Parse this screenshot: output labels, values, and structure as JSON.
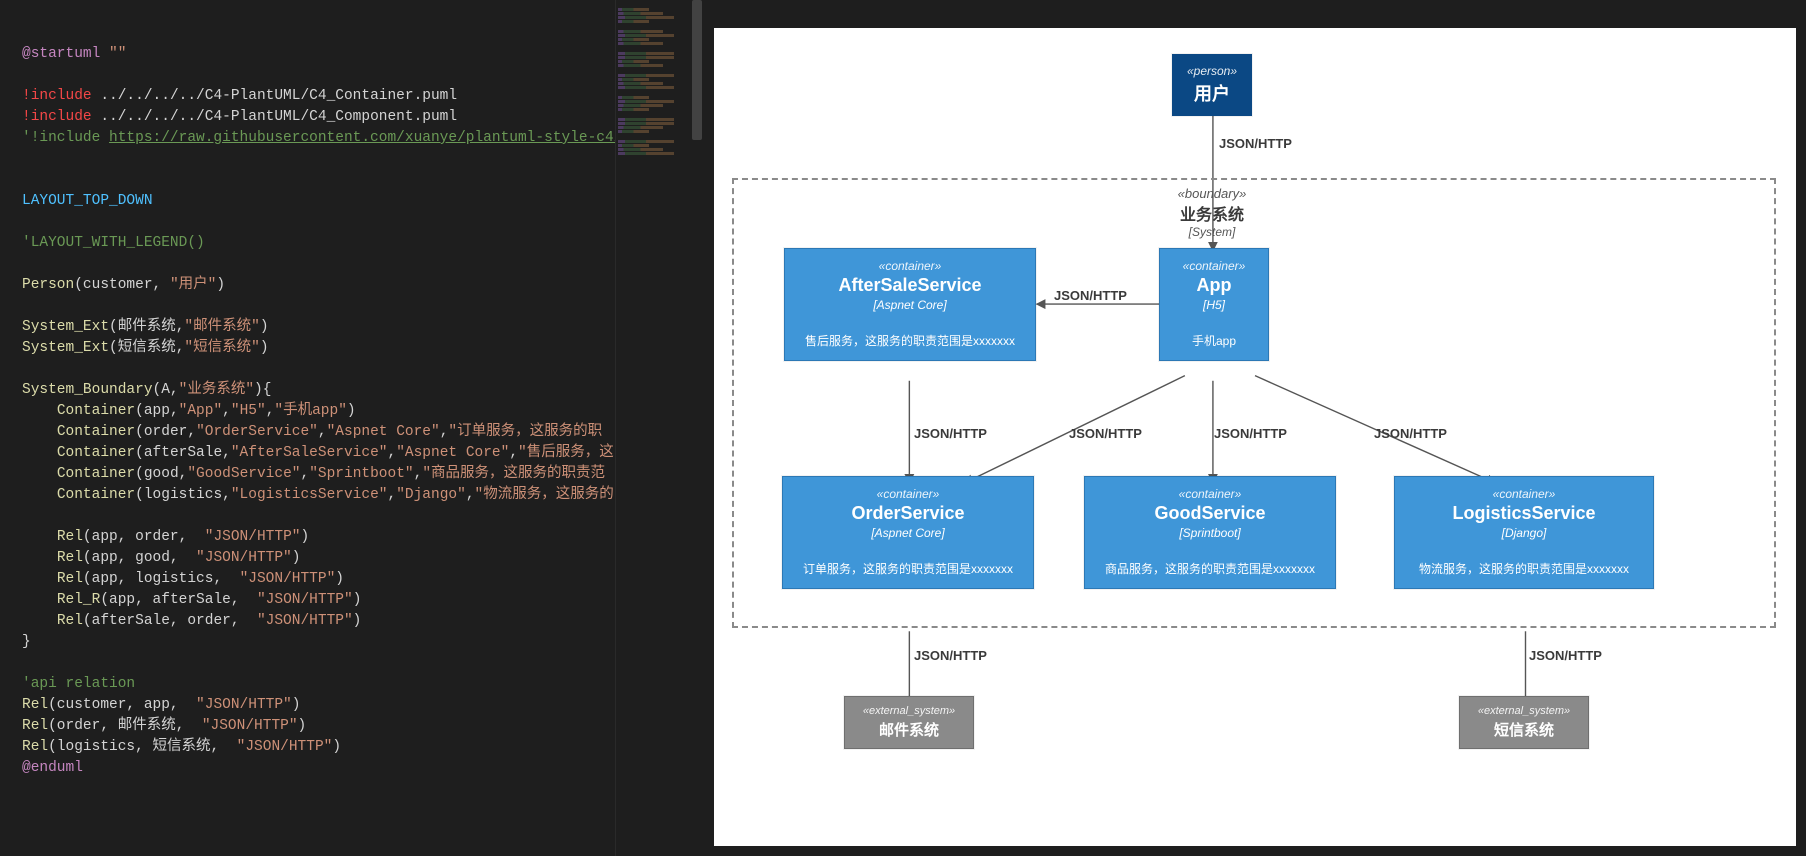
{
  "code": {
    "lines": [
      {
        "segments": [
          {
            "cls": "c-purple",
            "t": "@startuml"
          },
          {
            "cls": "c-string",
            "t": " \"\""
          }
        ]
      },
      {
        "segments": [
          {
            "cls": "",
            "t": ""
          }
        ]
      },
      {
        "segments": [
          {
            "cls": "c-red",
            "t": "!include"
          },
          {
            "cls": "c-default",
            "t": " ../../../../C4-PlantUML/C4_Container.puml"
          }
        ]
      },
      {
        "segments": [
          {
            "cls": "c-red",
            "t": "!include"
          },
          {
            "cls": "c-default",
            "t": " ../../../../C4-PlantUML/C4_Component.puml"
          }
        ]
      },
      {
        "segments": [
          {
            "cls": "c-comment",
            "t": "'!include "
          },
          {
            "cls": "c-comment underline",
            "t": "https://raw.githubusercontent.com/xuanye/plantuml-style-c4/"
          }
        ]
      },
      {
        "segments": [
          {
            "cls": "",
            "t": ""
          }
        ]
      },
      {
        "segments": [
          {
            "cls": "",
            "t": ""
          }
        ]
      },
      {
        "segments": [
          {
            "cls": "c-teal",
            "t": "LAYOUT_TOP_DOWN"
          }
        ]
      },
      {
        "segments": [
          {
            "cls": "",
            "t": ""
          }
        ]
      },
      {
        "segments": [
          {
            "cls": "c-comment",
            "t": "'LAYOUT_WITH_LEGEND()"
          }
        ]
      },
      {
        "segments": [
          {
            "cls": "",
            "t": ""
          }
        ]
      },
      {
        "segments": [
          {
            "cls": "c-yellow",
            "t": "Person"
          },
          {
            "cls": "c-default",
            "t": "(customer, "
          },
          {
            "cls": "c-string",
            "t": "\"用户\""
          },
          {
            "cls": "c-default",
            "t": ")"
          }
        ]
      },
      {
        "segments": [
          {
            "cls": "",
            "t": ""
          }
        ]
      },
      {
        "segments": [
          {
            "cls": "c-yellow",
            "t": "System_Ext"
          },
          {
            "cls": "c-default",
            "t": "(邮件系统,"
          },
          {
            "cls": "c-string",
            "t": "\"邮件系统\""
          },
          {
            "cls": "c-default",
            "t": ")"
          }
        ]
      },
      {
        "segments": [
          {
            "cls": "c-yellow",
            "t": "System_Ext"
          },
          {
            "cls": "c-default",
            "t": "(短信系统,"
          },
          {
            "cls": "c-string",
            "t": "\"短信系统\""
          },
          {
            "cls": "c-default",
            "t": ")"
          }
        ]
      },
      {
        "segments": [
          {
            "cls": "",
            "t": ""
          }
        ]
      },
      {
        "segments": [
          {
            "cls": "c-yellow",
            "t": "System_Boundary"
          },
          {
            "cls": "c-default",
            "t": "(A,"
          },
          {
            "cls": "c-string",
            "t": "\"业务系统\""
          },
          {
            "cls": "c-default",
            "t": "){"
          }
        ]
      },
      {
        "segments": [
          {
            "cls": "c-default",
            "t": "    "
          },
          {
            "cls": "c-yellow",
            "t": "Container"
          },
          {
            "cls": "c-default",
            "t": "(app,"
          },
          {
            "cls": "c-string",
            "t": "\"App\""
          },
          {
            "cls": "c-default",
            "t": ","
          },
          {
            "cls": "c-string",
            "t": "\"H5\""
          },
          {
            "cls": "c-default",
            "t": ","
          },
          {
            "cls": "c-string",
            "t": "\"手机app\""
          },
          {
            "cls": "c-default",
            "t": ")"
          }
        ]
      },
      {
        "segments": [
          {
            "cls": "c-default",
            "t": "    "
          },
          {
            "cls": "c-yellow",
            "t": "Container"
          },
          {
            "cls": "c-default",
            "t": "(order,"
          },
          {
            "cls": "c-string",
            "t": "\"OrderService\""
          },
          {
            "cls": "c-default",
            "t": ","
          },
          {
            "cls": "c-string",
            "t": "\"Aspnet Core\""
          },
          {
            "cls": "c-default",
            "t": ","
          },
          {
            "cls": "c-string",
            "t": "\"订单服务，这服务的职"
          }
        ]
      },
      {
        "segments": [
          {
            "cls": "c-default",
            "t": "    "
          },
          {
            "cls": "c-yellow",
            "t": "Container"
          },
          {
            "cls": "c-default",
            "t": "(afterSale,"
          },
          {
            "cls": "c-string",
            "t": "\"AfterSaleService\""
          },
          {
            "cls": "c-default",
            "t": ","
          },
          {
            "cls": "c-string",
            "t": "\"Aspnet Core\""
          },
          {
            "cls": "c-default",
            "t": ","
          },
          {
            "cls": "c-string",
            "t": "\"售后服务，这"
          }
        ]
      },
      {
        "segments": [
          {
            "cls": "c-default",
            "t": "    "
          },
          {
            "cls": "c-yellow",
            "t": "Container"
          },
          {
            "cls": "c-default",
            "t": "(good,"
          },
          {
            "cls": "c-string",
            "t": "\"GoodService\""
          },
          {
            "cls": "c-default",
            "t": ","
          },
          {
            "cls": "c-string",
            "t": "\"Sprintboot\""
          },
          {
            "cls": "c-default",
            "t": ","
          },
          {
            "cls": "c-string",
            "t": "\"商品服务，这服务的职责范"
          }
        ]
      },
      {
        "segments": [
          {
            "cls": "c-default",
            "t": "    "
          },
          {
            "cls": "c-yellow",
            "t": "Container"
          },
          {
            "cls": "c-default",
            "t": "(logistics,"
          },
          {
            "cls": "c-string",
            "t": "\"LogisticsService\""
          },
          {
            "cls": "c-default",
            "t": ","
          },
          {
            "cls": "c-string",
            "t": "\"Django\""
          },
          {
            "cls": "c-default",
            "t": ","
          },
          {
            "cls": "c-string",
            "t": "\"物流服务，这服务的"
          }
        ]
      },
      {
        "segments": [
          {
            "cls": "",
            "t": ""
          }
        ]
      },
      {
        "segments": [
          {
            "cls": "c-default",
            "t": "    "
          },
          {
            "cls": "c-yellow",
            "t": "Rel"
          },
          {
            "cls": "c-default",
            "t": "(app, order,  "
          },
          {
            "cls": "c-string",
            "t": "\"JSON/HTTP\""
          },
          {
            "cls": "c-default",
            "t": ")"
          }
        ]
      },
      {
        "segments": [
          {
            "cls": "c-default",
            "t": "    "
          },
          {
            "cls": "c-yellow",
            "t": "Rel"
          },
          {
            "cls": "c-default",
            "t": "(app, good,  "
          },
          {
            "cls": "c-string",
            "t": "\"JSON/HTTP\""
          },
          {
            "cls": "c-default",
            "t": ")"
          }
        ]
      },
      {
        "segments": [
          {
            "cls": "c-default",
            "t": "    "
          },
          {
            "cls": "c-yellow",
            "t": "Rel"
          },
          {
            "cls": "c-default",
            "t": "(app, logistics,  "
          },
          {
            "cls": "c-string",
            "t": "\"JSON/HTTP\""
          },
          {
            "cls": "c-default",
            "t": ")"
          }
        ]
      },
      {
        "segments": [
          {
            "cls": "c-default",
            "t": "    "
          },
          {
            "cls": "c-yellow",
            "t": "Rel_R"
          },
          {
            "cls": "c-default",
            "t": "(app, afterSale,  "
          },
          {
            "cls": "c-string",
            "t": "\"JSON/HTTP\""
          },
          {
            "cls": "c-default",
            "t": ")"
          }
        ]
      },
      {
        "segments": [
          {
            "cls": "c-default",
            "t": "    "
          },
          {
            "cls": "c-yellow",
            "t": "Rel"
          },
          {
            "cls": "c-default",
            "t": "(afterSale, order,  "
          },
          {
            "cls": "c-string",
            "t": "\"JSON/HTTP\""
          },
          {
            "cls": "c-default",
            "t": ")"
          }
        ]
      },
      {
        "segments": [
          {
            "cls": "c-default",
            "t": "}"
          }
        ]
      },
      {
        "segments": [
          {
            "cls": "",
            "t": ""
          }
        ]
      },
      {
        "segments": [
          {
            "cls": "c-comment",
            "t": "'api relation"
          }
        ]
      },
      {
        "segments": [
          {
            "cls": "c-yellow",
            "t": "Rel"
          },
          {
            "cls": "c-default",
            "t": "(customer, app,  "
          },
          {
            "cls": "c-string",
            "t": "\"JSON/HTTP\""
          },
          {
            "cls": "c-default",
            "t": ")"
          }
        ]
      },
      {
        "segments": [
          {
            "cls": "c-yellow",
            "t": "Rel"
          },
          {
            "cls": "c-default",
            "t": "(order, 邮件系统,  "
          },
          {
            "cls": "c-string",
            "t": "\"JSON/HTTP\""
          },
          {
            "cls": "c-default",
            "t": ")"
          }
        ]
      },
      {
        "segments": [
          {
            "cls": "c-yellow",
            "t": "Rel"
          },
          {
            "cls": "c-default",
            "t": "(logistics, 短信系统,  "
          },
          {
            "cls": "c-string",
            "t": "\"JSON/HTTP\""
          },
          {
            "cls": "c-default",
            "t": ")"
          }
        ]
      },
      {
        "segments": [
          {
            "cls": "c-purple",
            "t": "@enduml"
          }
        ]
      }
    ]
  },
  "diagram": {
    "person": {
      "stereo": "«person»",
      "title": "用户"
    },
    "boundary": {
      "stereo": "«boundary»",
      "title": "业务系统",
      "sub": "[System]"
    },
    "containers": {
      "afterSale": {
        "stereo": "«container»",
        "title": "AfterSaleService",
        "tech": "[Aspnet Core]",
        "desc": "售后服务，这服务的职责范围是xxxxxxx"
      },
      "app": {
        "stereo": "«container»",
        "title": "App",
        "tech": "[H5]",
        "desc": "手机app"
      },
      "order": {
        "stereo": "«container»",
        "title": "OrderService",
        "tech": "[Aspnet Core]",
        "desc": "订单服务，这服务的职责范围是xxxxxxx"
      },
      "good": {
        "stereo": "«container»",
        "title": "GoodService",
        "tech": "[Sprintboot]",
        "desc": "商品服务，这服务的职责范围是xxxxxxx"
      },
      "logistics": {
        "stereo": "«container»",
        "title": "LogisticsService",
        "tech": "[Django]",
        "desc": "物流服务，这服务的职责范围是xxxxxxx"
      }
    },
    "ext": {
      "mail": {
        "stereo": "«external_system»",
        "title": "邮件系统"
      },
      "sms": {
        "stereo": "«external_system»",
        "title": "短信系统"
      }
    },
    "edgeLabel": "JSON/HTTP"
  }
}
